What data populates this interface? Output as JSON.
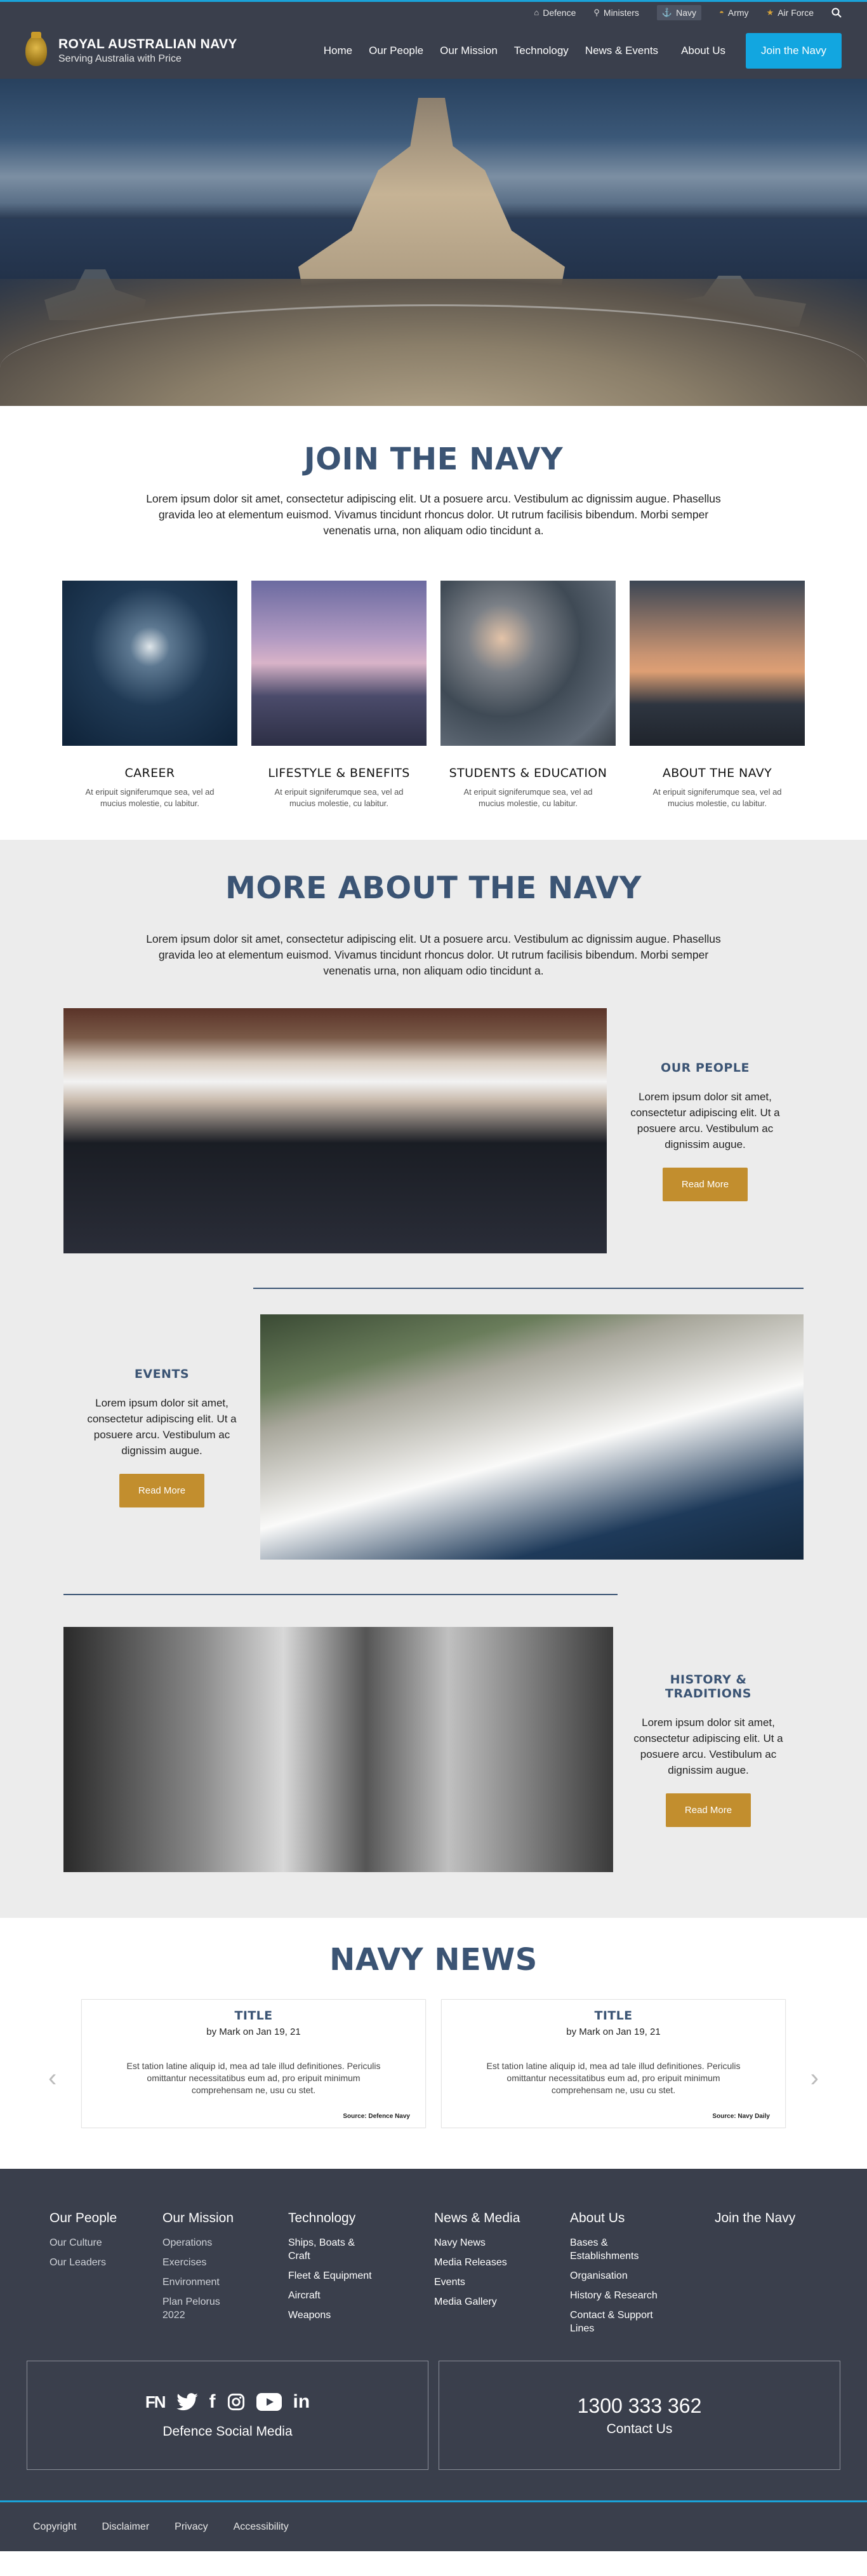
{
  "utility_bar": {
    "items": [
      {
        "label": "Defence",
        "icon": "home-icon"
      },
      {
        "label": "Ministers",
        "icon": "person-icon"
      },
      {
        "label": "Navy",
        "icon": "anchor-icon"
      },
      {
        "label": "Army",
        "icon": "hat-icon"
      },
      {
        "label": "Air Force",
        "icon": "star-icon"
      }
    ],
    "search_icon": "search-icon"
  },
  "header": {
    "title": "ROYAL AUSTRALIAN NAVY",
    "subtitle": "Serving Australia with Price",
    "nav": [
      "Home",
      "Our People",
      "Our Mission",
      "Technology",
      "News & Events",
      "About Us"
    ],
    "join_label": "Join the Navy"
  },
  "join": {
    "title": "JOIN THE NAVY",
    "intro": "Lorem ipsum dolor sit amet, consectetur adipiscing elit. Ut a posuere arcu. Vestibulum ac dignissim augue. Phasellus gravida leo at elementum euismod. Vivamus tincidunt rhoncus dolor. Ut rutrum facilisis bibendum. Morbi semper venenatis urna, non aliquam odio tincidunt a.",
    "cards": [
      {
        "title": "CAREER",
        "text": "At eripuit signiferumque sea, vel ad mucius molestie, cu labitur."
      },
      {
        "title": "LIFESTYLE & BENEFITS",
        "text": "At eripuit signiferumque sea, vel ad mucius molestie, cu labitur."
      },
      {
        "title": "STUDENTS & EDUCATION",
        "text": "At eripuit signiferumque sea, vel ad mucius molestie, cu labitur."
      },
      {
        "title": "ABOUT THE NAVY",
        "text": "At eripuit signiferumque sea, vel ad mucius molestie, cu labitur."
      }
    ]
  },
  "more": {
    "title": "MORE ABOUT THE NAVY",
    "intro": "Lorem ipsum dolor sit amet, consectetur adipiscing elit. Ut a posuere arcu. Vestibulum ac dignissim augue. Phasellus gravida leo at elementum euismod. Vivamus tincidunt rhoncus dolor. Ut rutrum facilisis bibendum. Morbi semper venenatis urna, non aliquam odio tincidunt a.",
    "features": [
      {
        "title": "OUR PEOPLE",
        "text": "Lorem ipsum dolor sit amet, consectetur adipiscing elit. Ut a posuere arcu. Vestibulum ac dignissim augue.",
        "button": "Read More"
      },
      {
        "title": "EVENTS",
        "text": "Lorem ipsum dolor sit amet, consectetur adipiscing elit. Ut a posuere arcu. Vestibulum ac dignissim augue.",
        "button": "Read More"
      },
      {
        "title": "HISTORY & TRADITIONS",
        "text": "Lorem ipsum dolor sit amet, consectetur adipiscing elit. Ut a posuere arcu. Vestibulum ac dignissim augue.",
        "button": "Read More"
      }
    ]
  },
  "news": {
    "title": "NAVY NEWS",
    "items": [
      {
        "title": "TITLE",
        "byline": "by Mark on Jan 19, 21",
        "body": "Est tation latine aliquip id, mea ad tale illud definitiones. Periculis omittantur necessitatibus eum ad, pro eripuit minimum comprehensam ne, usu cu stet.",
        "source": "Source: Defence Navy"
      },
      {
        "title": "TITLE",
        "byline": "by Mark on Jan 19, 21",
        "body": "Est tation latine aliquip id, mea ad tale illud definitiones. Periculis omittantur necessitatibus eum ad, pro eripuit minimum comprehensam ne, usu cu stet.",
        "source": "Source: Navy Daily"
      }
    ]
  },
  "footer": {
    "columns": [
      {
        "heading": "Our People",
        "items": [
          "Our Culture",
          "Our Leaders"
        ]
      },
      {
        "heading": "Our Mission",
        "items": [
          "Operations",
          "Exercises",
          "Environment",
          "Plan Pelorus 2022"
        ]
      },
      {
        "heading": "Technology",
        "items": [
          "Ships, Boats & Craft",
          "Fleet & Equipment",
          "Aircraft",
          "Weapons"
        ]
      },
      {
        "heading": "News & Media",
        "items": [
          "Navy News",
          "Media Releases",
          "Events",
          "Media Gallery"
        ]
      },
      {
        "heading": "About Us",
        "items": [
          "Bases & Establishments",
          "Organisation",
          "History & Research",
          "Contact & Support Lines"
        ]
      },
      {
        "heading": "Join the Navy",
        "items": []
      }
    ],
    "social_label": "Defence Social Media",
    "social_icons": [
      "defence-icon",
      "twitter-icon",
      "facebook-icon",
      "instagram-icon",
      "youtube-icon",
      "linkedin-icon"
    ],
    "phone": "1300 333 362",
    "contact_label": "Contact Us"
  },
  "bottom_bar": [
    "Copyright",
    "Disclaimer",
    "Privacy",
    "Accessibility"
  ]
}
